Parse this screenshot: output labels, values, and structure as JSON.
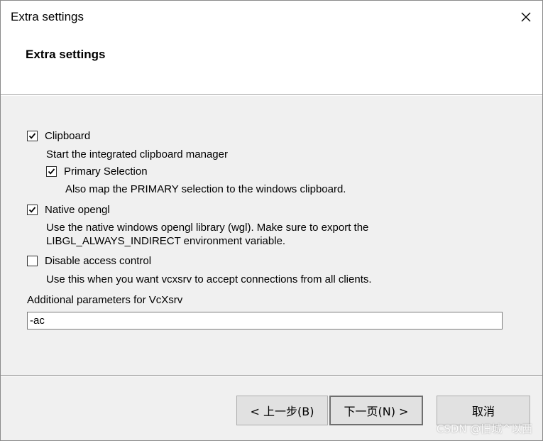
{
  "window": {
    "title": "Extra settings"
  },
  "header": {
    "title": "Extra settings"
  },
  "options": {
    "clipboard": {
      "label": "Clipboard",
      "checked": true,
      "description": "Start the integrated clipboard manager"
    },
    "primary_selection": {
      "label": "Primary Selection",
      "checked": true,
      "description": "Also map the PRIMARY selection to the windows clipboard."
    },
    "native_opengl": {
      "label": "Native opengl",
      "checked": true,
      "description_line1": "Use the native windows opengl library (wgl). Make sure to export the",
      "description_line2": "LIBGL_ALWAYS_INDIRECT environment variable."
    },
    "disable_access_control": {
      "label": "Disable access control",
      "checked": false,
      "description": "Use this when you want vcxsrv to accept connections from all clients."
    }
  },
  "parameters": {
    "label": "Additional parameters for VcXsrv",
    "value": "-ac"
  },
  "buttons": {
    "back": "< 上一步(B)",
    "next": "下一页(N) >",
    "cancel": "取消"
  },
  "watermark": "CSDN @旧城^以西"
}
